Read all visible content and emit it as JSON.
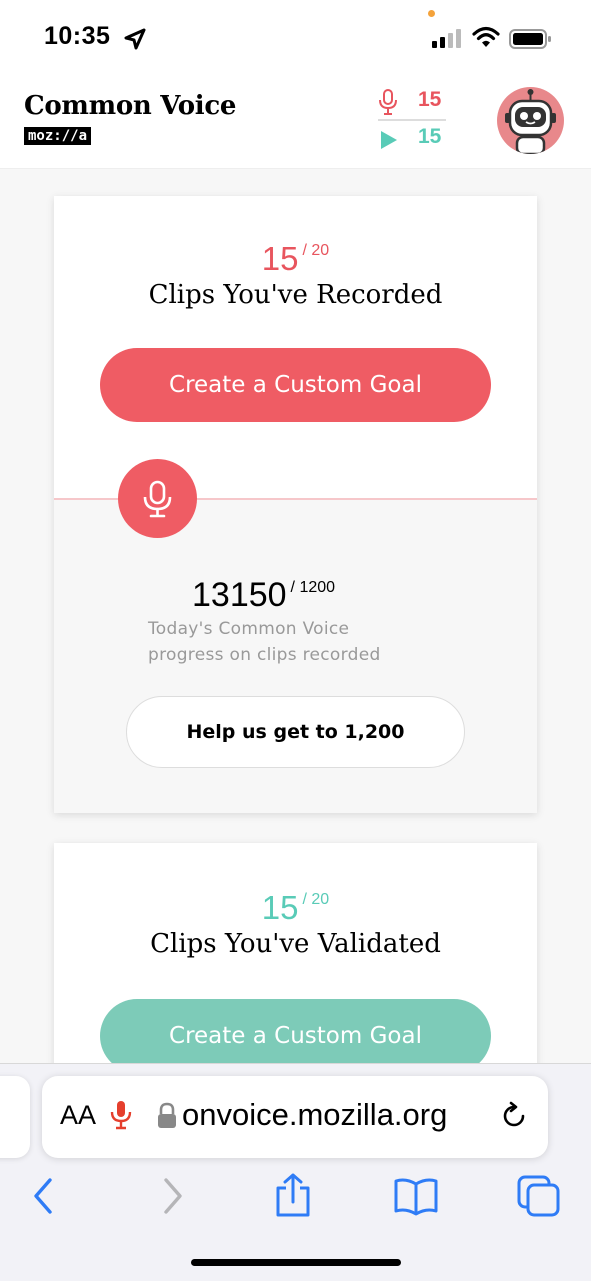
{
  "status_bar": {
    "time": "10:35"
  },
  "header": {
    "brand_title": "Common Voice",
    "brand_logo": "moz://a",
    "recorded_count": "15",
    "validated_count": "15"
  },
  "record_card": {
    "goal_value": "15",
    "goal_total": "/ 20",
    "goal_label": "Clips You've Recorded",
    "button_label": "Create a Custom Goal",
    "daily_value": "13150",
    "daily_total": "/ 1200",
    "daily_desc": "Today's Common Voice progress on clips recorded",
    "help_button": "Help us get to 1,200"
  },
  "validate_card": {
    "goal_value": "15",
    "goal_total": "/ 20",
    "goal_label": "Clips You've Validated",
    "button_label": "Create a Custom Goal"
  },
  "browser": {
    "aa_label": "AA",
    "url": "onvoice.mozilla.org"
  },
  "colors": {
    "record_accent": "#ef5c64",
    "validate_accent": "#59cbb7",
    "ios_blue": "#2f7cf6"
  },
  "icons": [
    "location-arrow-icon",
    "signal-icon",
    "wifi-icon",
    "battery-icon",
    "microphone-icon",
    "play-icon",
    "robot-avatar",
    "lock-icon",
    "reload-icon",
    "back-icon",
    "forward-icon",
    "share-icon",
    "bookmarks-icon",
    "tabs-icon"
  ]
}
